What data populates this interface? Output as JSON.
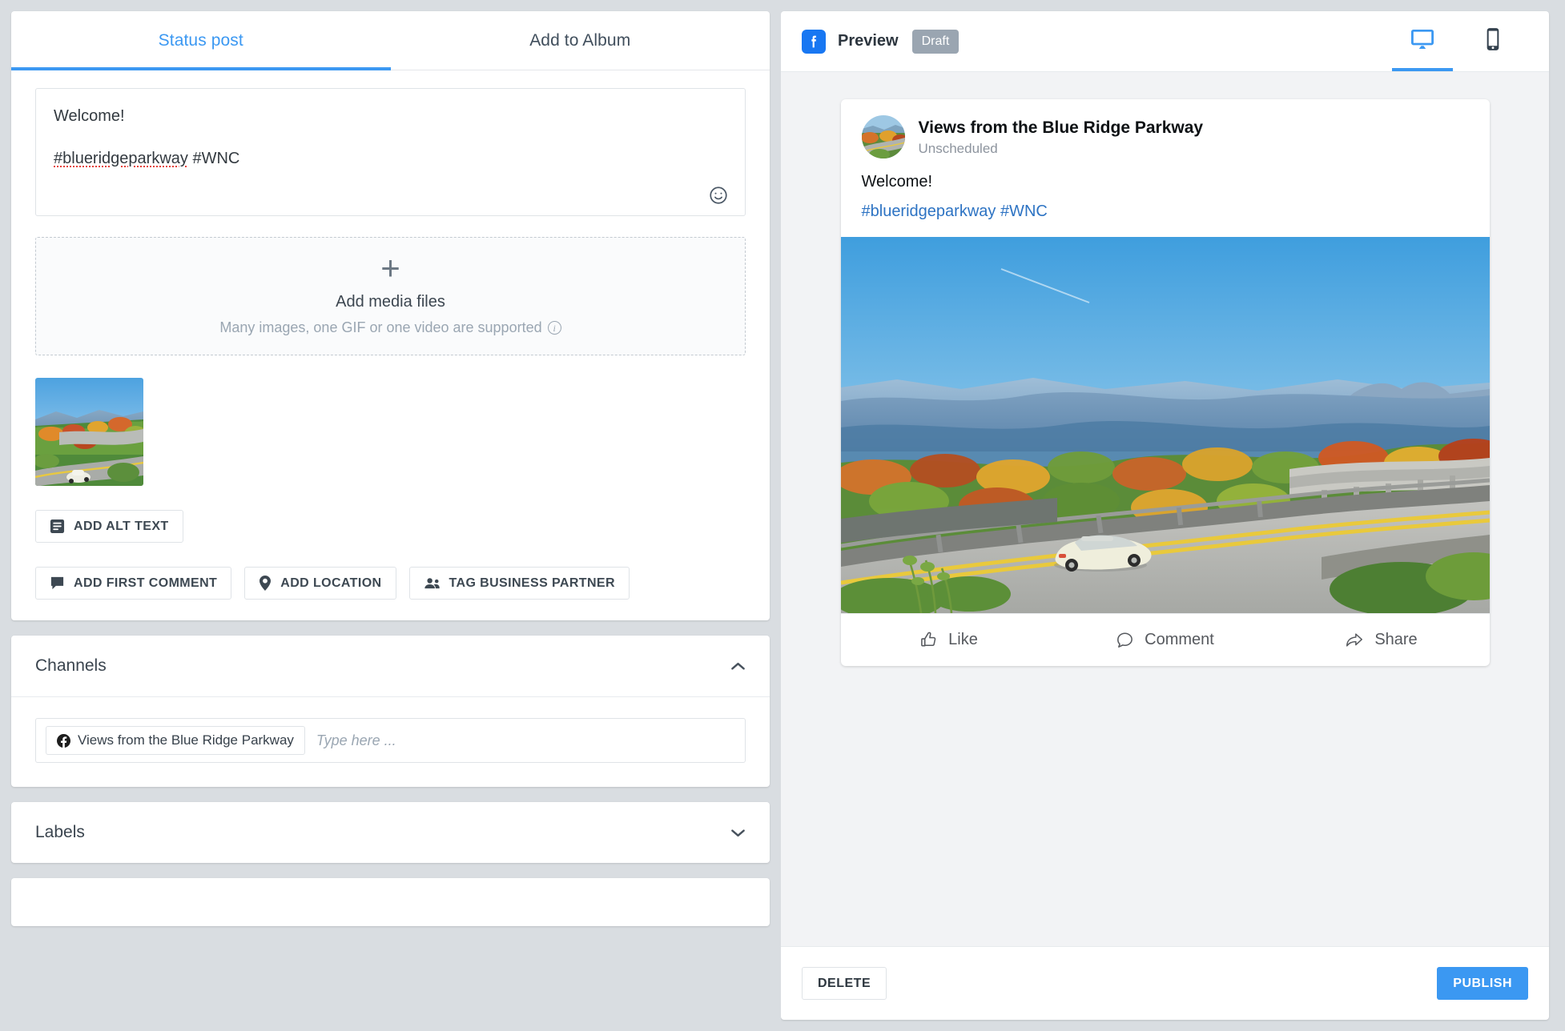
{
  "compose": {
    "tabs": [
      {
        "label": "Status post",
        "active": true
      },
      {
        "label": "Add to Album",
        "active": false
      }
    ],
    "editor": {
      "line1": "Welcome!",
      "hashtag_main": "#blueridgeparkway",
      "hashtag_second": " #WNC",
      "emoji_icon": "smiley-icon"
    },
    "dropzone": {
      "plus": "+",
      "title": "Add media files",
      "subtitle": "Many images, one GIF or one video are supported",
      "info_icon": "info-icon"
    },
    "attachment": {
      "alt_label": "Blue Ridge Parkway viaduct photo thumbnail"
    },
    "buttons": [
      {
        "label": "ADD ALT TEXT",
        "icon": "alt-text-icon"
      },
      {
        "label": "ADD FIRST COMMENT",
        "icon": "comment-filled-icon"
      },
      {
        "label": "ADD LOCATION",
        "icon": "location-pin-icon"
      },
      {
        "label": "TAG BUSINESS PARTNER",
        "icon": "people-icon"
      }
    ]
  },
  "channels": {
    "title": "Channels",
    "chevron": "chevron-up-icon",
    "selected": [
      {
        "name": "Views from the Blue Ridge Parkway",
        "icon": "facebook-icon"
      }
    ],
    "placeholder": "Type here ..."
  },
  "labels": {
    "title": "Labels",
    "chevron": "chevron-down-icon"
  },
  "preview": {
    "platform_icon": "facebook-icon",
    "title": "Preview",
    "status": "Draft",
    "views": [
      {
        "name": "desktop-view",
        "icon": "monitor-icon",
        "active": true
      },
      {
        "name": "mobile-view",
        "icon": "phone-icon",
        "active": false
      }
    ],
    "post": {
      "page_name": "Views from the Blue Ridge Parkway",
      "timestamp": "Unscheduled",
      "body": "Welcome!",
      "hashtags": "#blueridgeparkway #WNC",
      "image_alt": "Linn Cove Viaduct on the Blue Ridge Parkway in autumn with a car on the road",
      "actions": [
        {
          "label": "Like",
          "icon": "thumbs-up-icon"
        },
        {
          "label": "Comment",
          "icon": "comment-bubble-icon"
        },
        {
          "label": "Share",
          "icon": "share-arrow-icon"
        }
      ]
    },
    "footer": {
      "delete_label": "DELETE",
      "publish_label": "PUBLISH"
    }
  },
  "colors": {
    "accent": "#3b98f2",
    "facebook": "#1877f2",
    "link": "#2d73c3",
    "draft_badge": "#9aa5b1",
    "page_bg": "#d9dde1"
  }
}
